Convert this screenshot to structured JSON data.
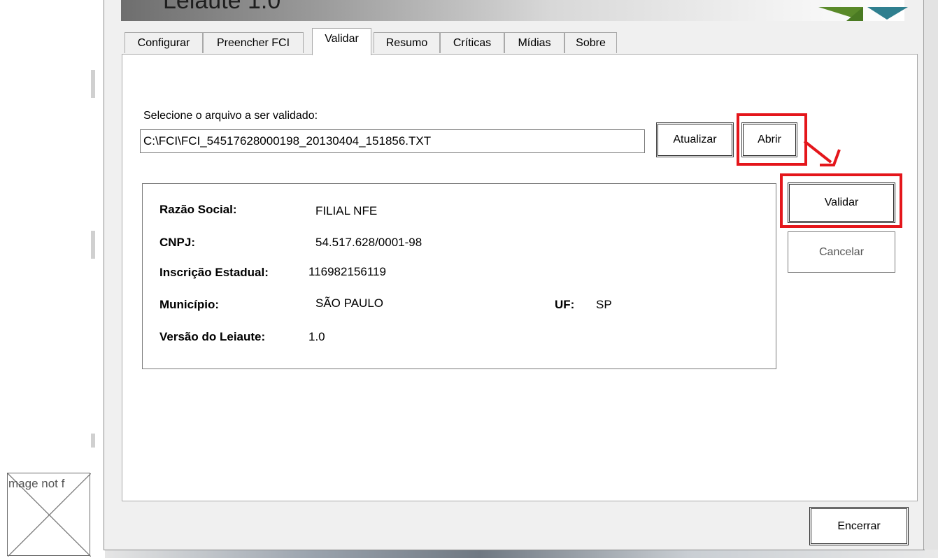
{
  "window": {
    "title": "Leiaute 1.0"
  },
  "tabs": [
    {
      "label": "Configurar",
      "active": false
    },
    {
      "label": "Preencher FCI",
      "active": false
    },
    {
      "label": "Validar",
      "active": true
    },
    {
      "label": "Resumo",
      "active": false
    },
    {
      "label": "Críticas",
      "active": false
    },
    {
      "label": "Mídias",
      "active": false
    },
    {
      "label": "Sobre",
      "active": false
    }
  ],
  "file": {
    "label": "Selecione o arquivo a ser validado:",
    "path": "C:\\FCI\\FCI_54517628000198_20130404_151856.TXT",
    "refresh_label": "Atualizar",
    "open_label": "Abrir"
  },
  "info": {
    "razao_social_label": "Razão Social:",
    "razao_social_value": "FILIAL NFE",
    "cnpj_label": "CNPJ:",
    "cnpj_value": "54.517.628/0001-98",
    "ie_label": "Inscrição Estadual:",
    "ie_value": "116982156119",
    "municipio_label": "Município:",
    "municipio_value": "SÃO PAULO",
    "uf_label": "UF:",
    "uf_value": "SP",
    "versao_label": "Versão do Leiaute:",
    "versao_value": "1.0"
  },
  "actions": {
    "validate_label": "Validar",
    "cancel_label": "Cancelar",
    "close_label": "Encerrar"
  },
  "broken_image": {
    "text": "mage not f"
  },
  "colors": {
    "highlight": "#e4161b",
    "logo_green": "#5a8a2a",
    "logo_teal": "#2f7f8f"
  },
  "icons": [
    "broken-image-icon",
    "red-arrow-annotation",
    "logo-icon"
  ]
}
